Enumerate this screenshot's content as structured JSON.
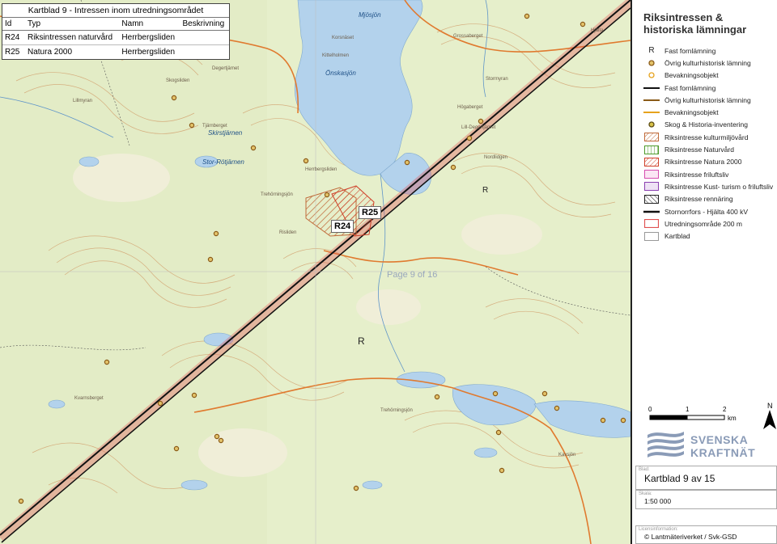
{
  "info_table": {
    "title": "Kartblad 9 - Intressen inom utredningsområdet",
    "headers": [
      "Id",
      "Typ",
      "Namn",
      "Beskrivning"
    ],
    "rows": [
      {
        "id": "R24",
        "typ": "Riksintressen naturvård",
        "namn": "Herrbergsliden",
        "beskrivning": ""
      },
      {
        "id": "R25",
        "typ": "Natura 2000",
        "namn": "Herrbergsliden",
        "beskrivning": ""
      }
    ]
  },
  "legend": {
    "title_line1": "Riksintressen &",
    "title_line2": "historiska lämningar",
    "items": [
      {
        "symbol": "R",
        "label": "Fast fornlämning"
      },
      {
        "symbol": "dot-brown",
        "label": "Övrig kulturhistorisk lämning"
      },
      {
        "symbol": "dot-orange",
        "label": "Bevakningsobjekt"
      },
      {
        "symbol": "line-black",
        "label": "Fast fornlämning"
      },
      {
        "symbol": "line-brown",
        "label": "Övrig kulturhistorisk lämning"
      },
      {
        "symbol": "line-orange",
        "label": "Bevakningsobjekt"
      },
      {
        "symbol": "dot-olive",
        "label": "Skog & Historia-inventering"
      },
      {
        "symbol": "hatch-brown",
        "label": "Riksintresse kulturmiljövård"
      },
      {
        "symbol": "hatch-green",
        "label": "Riksintresse Naturvård"
      },
      {
        "symbol": "hatch-red",
        "label": "Riksintresse Natura 2000"
      },
      {
        "symbol": "box-pink",
        "label": "Riksintresse friluftsliv"
      },
      {
        "symbol": "box-purple",
        "label": "Riksintresse Kust- turism o friluftsliv"
      },
      {
        "symbol": "hatch-black",
        "label": "Riksintresse rennäring"
      },
      {
        "symbol": "line-powerline",
        "label": "Stornorrfors - Hjälta 400 kV"
      },
      {
        "symbol": "box-red",
        "label": "Utredningsområde 200 m"
      },
      {
        "symbol": "box-grey",
        "label": "Kartblad"
      }
    ]
  },
  "scale_bar": {
    "ticks": [
      "0",
      "1",
      "2"
    ],
    "unit": "km",
    "north": "N"
  },
  "logo": {
    "line1": "SVENSKA",
    "line2": "KRAFTNÄT"
  },
  "footer": {
    "sheet_label": "Blad:",
    "sheet_value": "Kartblad 9 av 15",
    "scale_label": "Skala:",
    "scale_value": "1:50 000",
    "license_label": "Licensinformation:",
    "license_value": "© Lantmäteriverket / Svk-GSD"
  },
  "map": {
    "area_labels": [
      "R24",
      "R25"
    ],
    "page_watermark": "Page 9 of 16",
    "lakes": [
      "Önskasjön",
      "Mjösjön",
      "Skirstjärnen",
      "Stor-Rötjärnen"
    ],
    "places": [
      "Kartbladet",
      "Herrbergsliden",
      "Trehörningsjön",
      "Korsnäset",
      "Kittelholmen",
      "Tjärnberget",
      "Lillmyran",
      "Grossaberget",
      "Stormyran",
      "Hjälta",
      "Skogsliden",
      "Risliden",
      "Högaberget",
      "Degertjärnet",
      "Trehörningsjön",
      "Kavsjön",
      "Nordlidgen",
      "Kvarnsberget",
      "Lill-Degertjärnet"
    ],
    "colors": {
      "land": "#e9f0cf",
      "water": "#b3d2ec",
      "contour": "#d4a877",
      "road": "#e07a2f",
      "powerline": "#111111",
      "corridor": "#e05050"
    }
  }
}
